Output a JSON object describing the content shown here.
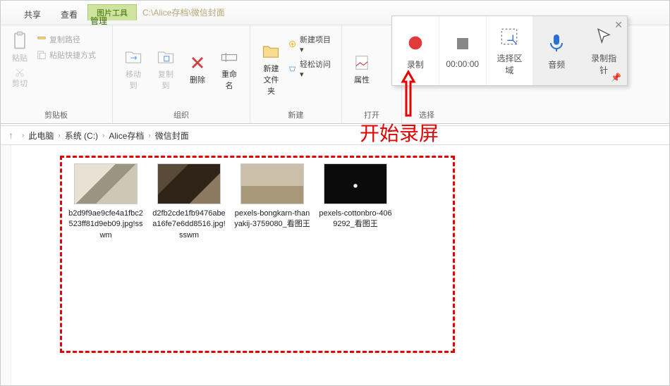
{
  "tabs": {
    "share": "共享",
    "view": "查看",
    "contextual": "图片工具",
    "manage": "管理"
  },
  "pathText": "C:\\Alice存档\\微信封面",
  "ribbon": {
    "clipboard": {
      "label": "剪贴板",
      "copyPath": "复制路径",
      "pasteShortcut": "粘贴快捷方式",
      "paste": "粘贴",
      "cut": "剪切"
    },
    "organize": {
      "label": "组织",
      "moveTo": "移动到",
      "copyTo": "复制到",
      "delete": "删除",
      "rename": "重命名"
    },
    "new": {
      "label": "新建",
      "newFolder": "新建\n文件夹",
      "newItem": "新建项目 ▾",
      "easyAccess": "轻松访问 ▾"
    },
    "open": {
      "label": "打开",
      "props": "属性"
    },
    "select": {
      "label": "选择"
    }
  },
  "rec": {
    "record": "录制",
    "time": "00:00:00",
    "region": "选择区\n域",
    "audio": "音频",
    "pointer": "录制指\n针"
  },
  "annotation": "开始录屏",
  "breadcrumb": {
    "pc": "此电脑",
    "drive": "系统 (C:)",
    "folder1": "Alice存档",
    "folder2": "微信封面"
  },
  "files": [
    {
      "name": "b2d9f9ae9cfe4a1fbc2523ff81d9eb09.jpg!sswm"
    },
    {
      "name": "d2fb2cde1fb9476abea16fe7e6dd8516.jpg!sswm"
    },
    {
      "name": "pexels-bongkarn-thanyakij-3759080_看图王"
    },
    {
      "name": "pexels-cottonbro-4069292_看图王"
    }
  ]
}
